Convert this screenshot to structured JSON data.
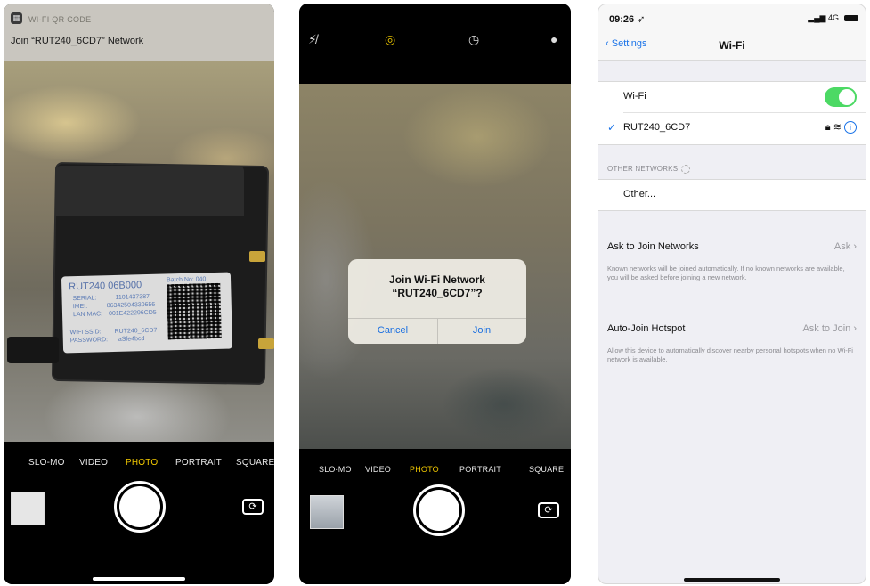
{
  "screen1": {
    "notification": {
      "app_name": "WI-FI QR CODE",
      "message": "Join “RUT240_6CD7” Network"
    },
    "device_label": {
      "model": "RUT240 06B000",
      "batch": "Batch No: 040",
      "serial_label": "SERIAL:",
      "serial_value": "1101437387",
      "imei_label": "IMEI:",
      "imei_value": "86342504330656",
      "mac_label": "LAN MAC:",
      "mac_value": "001E422296CD5",
      "ssid_label": "WIFI SSID:",
      "ssid_value": "RUT240_6CD7",
      "password_label": "PASSWORD:",
      "password_value": "aSfe4bcd"
    },
    "camera_modes": [
      "SLO-MO",
      "VIDEO",
      "PHOTO",
      "PORTRAIT",
      "SQUARE"
    ],
    "active_mode": "PHOTO"
  },
  "screen2": {
    "alert": {
      "title": "Join Wi-Fi Network",
      "network": "“RUT240_6CD7”?",
      "cancel": "Cancel",
      "join": "Join"
    },
    "camera_modes": [
      "SLO-MO",
      "VIDEO",
      "PHOTO",
      "PORTRAIT",
      "SQUARE"
    ],
    "active_mode": "PHOTO"
  },
  "screen3": {
    "status": {
      "time": "09:26",
      "network": "4G"
    },
    "nav": {
      "back": "Settings",
      "title": "Wi-Fi"
    },
    "wifi_row": {
      "label": "Wi-Fi",
      "enabled": true
    },
    "connected_network": "RUT240_6CD7",
    "other_networks_header": "OTHER NETWORKS",
    "other_row": "Other...",
    "ask_to_join": {
      "label": "Ask to Join Networks",
      "value": "Ask",
      "footnote": "Known networks will be joined automatically. If no known networks are available, you will be asked before joining a new network."
    },
    "auto_join": {
      "label": "Auto-Join Hotspot",
      "value": "Ask to Join",
      "footnote": "Allow this device to automatically discover nearby personal hotspots when no Wi-Fi network is available."
    }
  }
}
